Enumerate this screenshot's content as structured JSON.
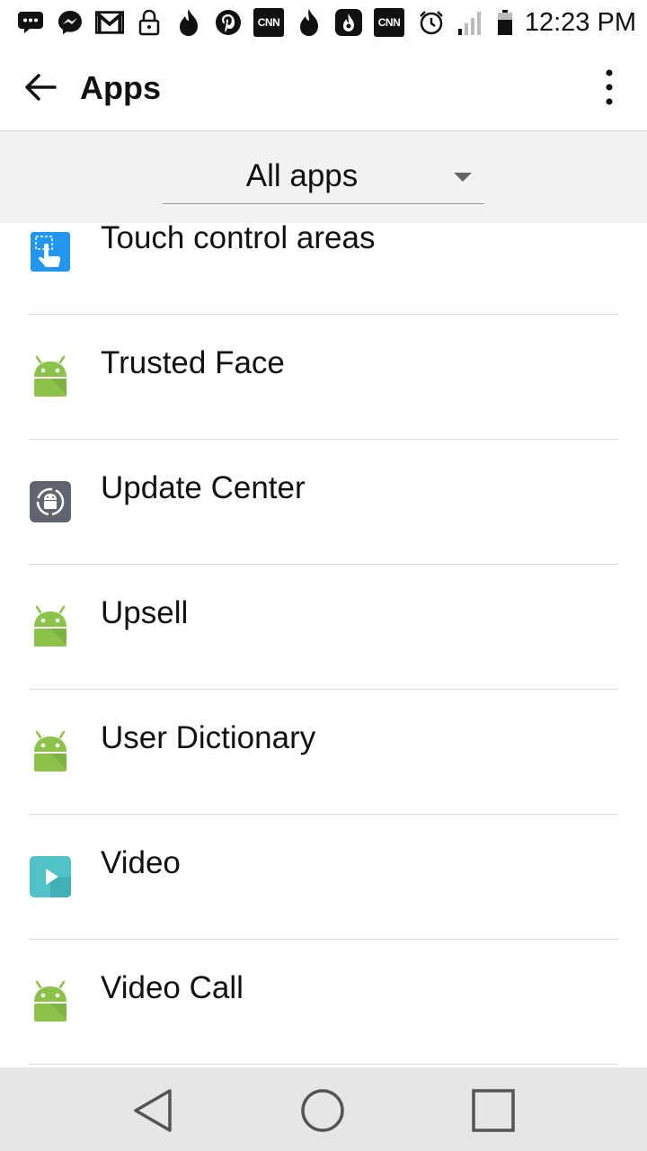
{
  "status_bar": {
    "time": "12:23 PM",
    "cnn_text": "CNN",
    "icons": [
      "sms-icon",
      "messenger-icon",
      "gmail-icon",
      "lock-icon",
      "flame-icon",
      "pinterest-icon",
      "cnn-icon",
      "flame-icon",
      "hotspot-icon",
      "cnn-icon",
      "alarm-icon",
      "signal-icon",
      "battery-icon"
    ]
  },
  "app_bar": {
    "title": "Apps"
  },
  "filter": {
    "selected": "All apps"
  },
  "apps": [
    {
      "label": "Touch control areas",
      "icon": "touch-control-icon"
    },
    {
      "label": "Trusted Face",
      "icon": "android-icon"
    },
    {
      "label": "Update Center",
      "icon": "update-center-icon"
    },
    {
      "label": "Upsell",
      "icon": "android-icon"
    },
    {
      "label": "User Dictionary",
      "icon": "android-icon"
    },
    {
      "label": "Video",
      "icon": "video-icon"
    },
    {
      "label": "Video Call",
      "icon": "android-icon"
    }
  ],
  "colors": {
    "android_green": "#8bc34a",
    "touch_blue": "#2196f3",
    "update_gray": "#5f6470",
    "video_teal": "#4fc3c8",
    "filter_bg": "#f2f2f2",
    "nav_bg": "#e6e6e8"
  }
}
